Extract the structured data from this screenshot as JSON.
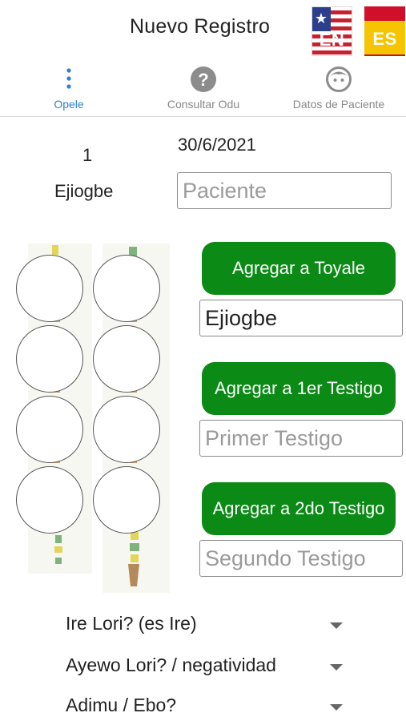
{
  "header": {
    "title": "Nuevo Registro",
    "languages": [
      {
        "code": "EN",
        "icon": "us-flag-icon"
      },
      {
        "code": "ES",
        "icon": "spain-flag-icon"
      }
    ]
  },
  "tabs": [
    {
      "label": "Opele",
      "icon": "vertical-dots-icon",
      "active": true
    },
    {
      "label": "Consultar Odu",
      "icon": "question-circle-icon",
      "active": false
    },
    {
      "label": "Datos de Paciente",
      "icon": "baby-face-icon",
      "active": false
    }
  ],
  "form": {
    "date": "30/6/2021",
    "count": "1",
    "odu_name": "Ejiogbe",
    "paciente_placeholder": "Paciente"
  },
  "actions": {
    "toyale_button": "Agregar a Toyale",
    "toyale_value": "Ejiogbe",
    "primer_button": "Agregar a 1er Testigo",
    "primer_placeholder": "Primer Testigo",
    "segundo_button": "Agregar a 2do Testigo",
    "segundo_placeholder": "Segundo Testigo"
  },
  "selects": [
    {
      "label": "Ire Lori? (es Ire)"
    },
    {
      "label": "Ayewo Lori? / negatividad"
    },
    {
      "label": "Adimu / Ebo?"
    }
  ],
  "colors": {
    "accent": "#2f7fd6",
    "button_green": "#0b8a16",
    "inactive_tab": "#888888"
  }
}
